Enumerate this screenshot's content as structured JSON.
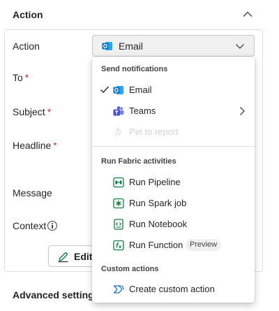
{
  "section": {
    "title": "Action"
  },
  "form": {
    "action_label": "Action",
    "to_label": "To",
    "subject_label": "Subject",
    "headline_label": "Headline",
    "message_label": "Message",
    "context_label": "Context",
    "required_mark": "*",
    "action_value": "Email",
    "edit_label": "Edit"
  },
  "advanced_label": "Advanced settings",
  "menu": {
    "group_notifications": "Send notifications",
    "group_fabric": "Run Fabric activities",
    "group_custom": "Custom actions",
    "items": [
      {
        "label": "Email",
        "icon": "outlook-icon",
        "selected": true
      },
      {
        "label": "Teams",
        "icon": "teams-icon",
        "has_submenu": true
      },
      {
        "label": "Pin to report",
        "icon": "pin-icon",
        "disabled": true
      },
      {
        "label": "Run Pipeline",
        "icon": "pipeline-icon"
      },
      {
        "label": "Run Spark job",
        "icon": "spark-job-icon"
      },
      {
        "label": "Run Notebook",
        "icon": "notebook-icon"
      },
      {
        "label": "Run Function",
        "icon": "function-icon",
        "badge": "Preview"
      },
      {
        "label": "Create custom action",
        "icon": "custom-action-icon"
      }
    ]
  },
  "colors": {
    "outlook_blue": "#0f6cbd",
    "teams_purple": "#5b5fc7",
    "fabric_green": "#107c41",
    "custom_blue": "#0f6cbd",
    "required_red": "#c4314b"
  }
}
